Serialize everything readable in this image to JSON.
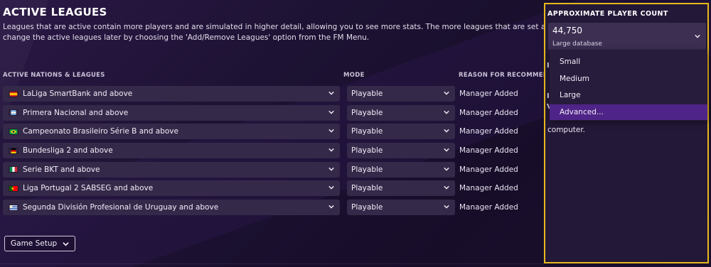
{
  "header": {
    "title": "ACTIVE LEAGUES",
    "description_line1": "Leagues that are active contain more players and are simulated in higher detail, allowing you to see more stats. The more leagues that are set as active, the lo",
    "description_line2": "change the active leagues later by choosing the 'Add/Remove Leagues' option from the FM Menu."
  },
  "columns": {
    "nations": "ACTIVE NATIONS & LEAGUES",
    "mode": "MODE",
    "reason": "REASON FOR RECOMMENDATI"
  },
  "leagues": [
    {
      "name": "LaLiga SmartBank and above",
      "mode": "Playable",
      "reason": "Manager Added",
      "flag": "spain"
    },
    {
      "name": "Primera Nacional and above",
      "mode": "Playable",
      "reason": "Manager Added",
      "flag": "argentina"
    },
    {
      "name": "Campeonato Brasileiro Série B and above",
      "mode": "Playable",
      "reason": "Manager Added",
      "flag": "brazil"
    },
    {
      "name": "Bundesliga 2 and above",
      "mode": "Playable",
      "reason": "Manager Added",
      "flag": "germany"
    },
    {
      "name": "Serie BKT and above",
      "mode": "Playable",
      "reason": "Manager Added",
      "flag": "italy"
    },
    {
      "name": "Liga Portugal 2 SABSEG and above",
      "mode": "Playable",
      "reason": "Manager Added",
      "flag": "portugal"
    },
    {
      "name": "Segunda División Profesional de Uruguay and above",
      "mode": "Playable",
      "reason": "Manager Added",
      "flag": "uruguay"
    }
  ],
  "footer": {
    "game_setup_label": "Game Setup"
  },
  "player_count": {
    "title": "APPROXIMATE PLAYER COUNT",
    "value": "44,750",
    "sub": "Large database",
    "options": [
      "Small",
      "Medium",
      "Large",
      "Advanced..."
    ],
    "selected_option": "Advanced...",
    "partial_letter_1": "I",
    "partial_letter_2": "I",
    "partial_letter_3": "V",
    "trailing_text": "computer."
  },
  "colors": {
    "accent_highlight": "#e8b91c",
    "selected_menu": "#4f2488",
    "dropdown_bg": "#35294a"
  }
}
